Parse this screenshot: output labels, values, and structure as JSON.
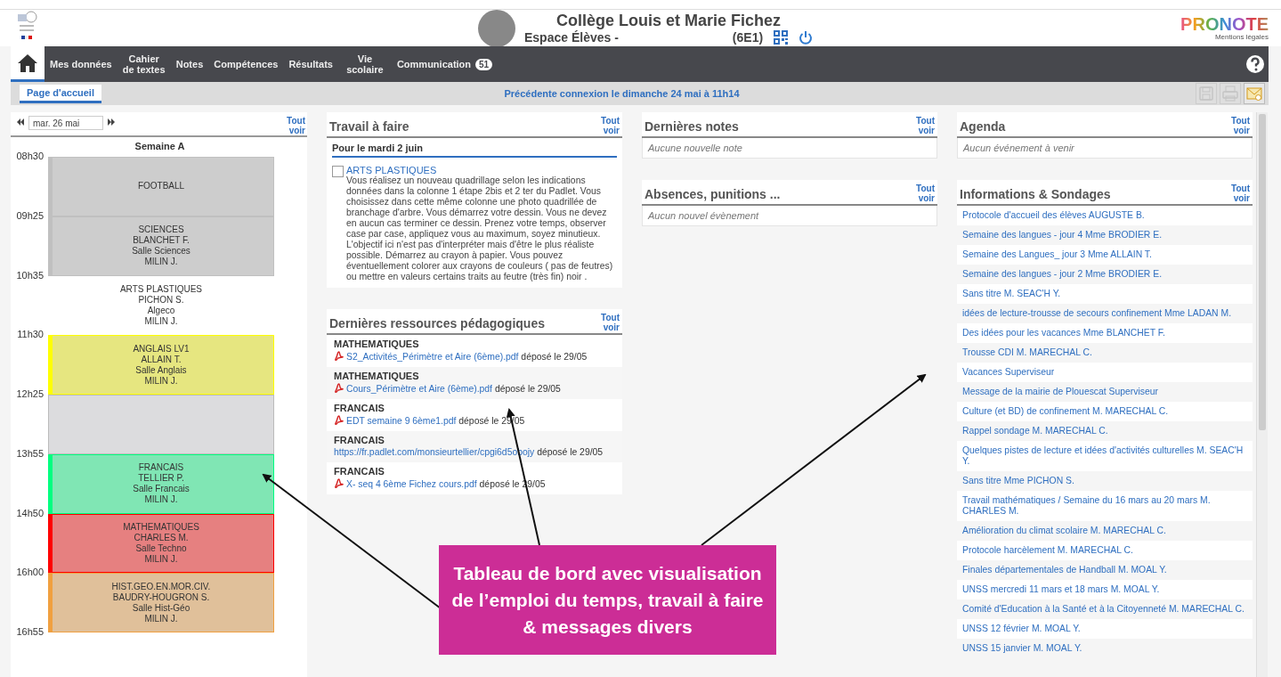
{
  "header": {
    "school": "Collège Louis et Marie Fichez",
    "space": "Espace Élèves -",
    "class": "(6E1)",
    "logo": "PRONOTE",
    "legal": "Mentions légales"
  },
  "nav": {
    "items": [
      {
        "kind": "home",
        "selected": true
      },
      {
        "kind": "menu",
        "label": "Mes données",
        "selected": false
      },
      {
        "kind": "menu",
        "label": "Cahier de textes",
        "selected": false
      },
      {
        "kind": "menu",
        "label": "Notes",
        "selected": false
      },
      {
        "kind": "menu",
        "label": "Compétences",
        "selected": false
      },
      {
        "kind": "menu",
        "label": "Résultats",
        "selected": false
      },
      {
        "kind": "menu",
        "label": "Vie scolaire",
        "selected": false
      },
      {
        "kind": "menu",
        "label": "Communication",
        "badge": "51",
        "selected": false
      }
    ]
  },
  "subbar": {
    "tabs": [
      {
        "label": "Page d'accueil",
        "selected": true
      }
    ],
    "last_connection": "Précédente connexion le dimanche 24 mai à 11h14",
    "tools": [
      {
        "kind": "save",
        "disabled": true
      },
      {
        "kind": "print",
        "disabled": true
      },
      {
        "kind": "mail",
        "disabled": false
      }
    ]
  },
  "timetable": {
    "date": "mar. 26 mai",
    "see_all": "Tout voir",
    "week": "Semaine A",
    "times": [
      "08h30",
      "09h25",
      "10h35",
      "11h30",
      "12h25",
      "13h55",
      "14h50",
      "16h00",
      "16h55"
    ],
    "lessons": [
      {
        "kind": "lesson",
        "color": "#c0c0c0",
        "lines": [
          "FOOTBALL"
        ]
      },
      {
        "kind": "lesson",
        "color": "#c0c0c0",
        "lines": [
          "SCIENCES",
          "BLANCHET F.",
          "Salle Sciences",
          "MILIN J."
        ]
      },
      {
        "kind": "free",
        "lines": [
          "ARTS PLASTIQUES",
          "PICHON S.",
          "Algeco",
          "MILIN J."
        ]
      },
      {
        "kind": "lesson",
        "color": "#ffff00",
        "lines": [
          "ANGLAIS LV1",
          "ALLAIN T.",
          "Salle Anglais",
          "MILIN J."
        ]
      },
      {
        "kind": "break"
      },
      {
        "kind": "lesson",
        "color": "#00ff80",
        "lines": [
          "FRANCAIS",
          "TELLIER P.",
          "Salle Francais",
          "MILIN J."
        ]
      },
      {
        "kind": "lesson",
        "color": "#ff0000",
        "lines": [
          "MATHEMATIQUES",
          "CHARLES M.",
          "Salle Techno",
          "MILIN J."
        ]
      },
      {
        "kind": "lesson",
        "color": "#f0a040",
        "lines": [
          "HIST.GEO.EN.MOR.CIV.",
          "BAUDRY-HOUGRON S.",
          "Salle Hist-Géo",
          "MILIN J."
        ]
      }
    ]
  },
  "homework": {
    "title": "Travail à faire",
    "see_all": "Tout voir",
    "date": "Pour le mardi 2 juin",
    "items": [
      {
        "subject": "ARTS PLASTIQUES",
        "done": false,
        "text": "Vous réalisez un nouveau quadrillage selon les indications données dans la colonne 1 étape 2bis et 2 ter du Padlet. Vous choisissez dans cette même colonne une photo quadrillée de branchage d'arbre. Vous démarrez votre dessin. Vous ne devez en aucun cas terminer ce dessin. Prenez votre temps, observer case par case, appliquez vous au maximum, soyez minutieux. L'objectif ici n'est pas d'interpréter mais d'être le plus réaliste possible. Démarrez au crayon à papier. Vous pouvez éventuellement colorer aux crayons de couleurs ( pas de feutres) ou mettre en valeurs certains traits au feutre (très fin) noir ."
      }
    ]
  },
  "resources": {
    "title": "Dernières ressources pédagogiques",
    "see_all": "Tout voir",
    "items": [
      {
        "subject": "MATHEMATIQUES",
        "kind": "file",
        "link": "S2_Activités_Périmètre et Aire (6ème).pdf",
        "note": "déposé le 29/05"
      },
      {
        "subject": "MATHEMATIQUES",
        "kind": "file",
        "link": "Cours_Périmètre et Aire (6ème).pdf",
        "note": "déposé le 29/05"
      },
      {
        "subject": "FRANCAIS",
        "kind": "file",
        "link": "EDT semaine 9 6ème1.pdf",
        "note": "déposé le 29/05"
      },
      {
        "subject": "FRANCAIS",
        "kind": "url",
        "link": "https://fr.padlet.com/monsieurtellier/cpgi6d5obojy",
        "note": "déposé le 29/05"
      },
      {
        "subject": "FRANCAIS",
        "kind": "file",
        "link": "X- seq 4 6ème Fichez cours.pdf",
        "note": "déposé le 29/05"
      }
    ]
  },
  "grades": {
    "title": "Dernières notes",
    "see_all": "Tout voir",
    "empty": "Aucune nouvelle note"
  },
  "absences": {
    "title": "Absences, punitions ...",
    "see_all": "Tout voir",
    "empty": "Aucun nouvel évènement"
  },
  "agenda": {
    "title": "Agenda",
    "see_all": "Tout voir",
    "empty": "Aucun événement à venir"
  },
  "info": {
    "title": "Informations & Sondages",
    "see_all": "Tout voir",
    "items": [
      "Protocole d'accueil des élèves AUGUSTE B.",
      "Semaine des langues - jour 4 Mme BRODIER E.",
      "Semaine des Langues_ jour 3 Mme ALLAIN T.",
      "Semaine des langues - jour 2 Mme BRODIER E.",
      "Sans titre M. SEAC'H Y.",
      "idées de lecture-trousse de secours confinement Mme LADAN M.",
      "Des idées pour les vacances Mme BLANCHET F.",
      "Trousse CDI M. MARECHAL C.",
      "Vacances Superviseur",
      "Message de la mairie de Plouescat Superviseur",
      "Culture (et BD) de confinement M. MARECHAL C.",
      "Rappel sondage M. MARECHAL C.",
      "Quelques pistes de lecture et idées d'activités culturelles M. SEAC'H Y.",
      "Sans titre Mme PICHON S.",
      "Travail mathématiques / Semaine du 16 mars au 20 mars M. CHARLES M.",
      "Amélioration du climat scolaire M. MARECHAL C.",
      "Protocole harcèlement M. MARECHAL C.",
      "Finales départementales de Handball M. MOAL Y.",
      "UNSS mercredi 11 mars et 18 mars M. MOAL Y.",
      "Comité d'Education à la Santé et à la Citoyenneté M. MARECHAL C.",
      "UNSS 12 février M. MOAL Y.",
      "UNSS 15 janvier M. MOAL Y."
    ]
  },
  "callout": {
    "text": "Tableau de bord avec visualisation de l’emploi du temps, travail à faire & messages divers"
  }
}
